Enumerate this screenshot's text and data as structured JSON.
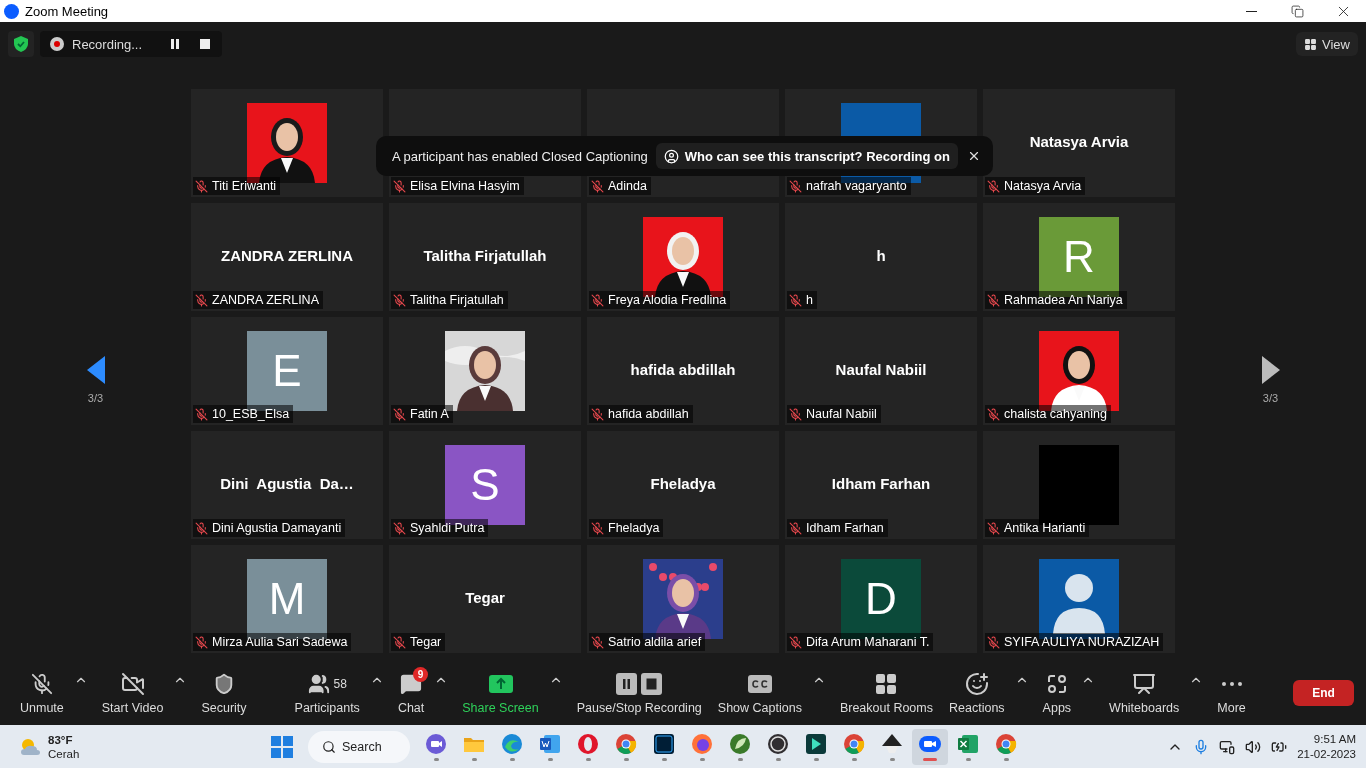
{
  "window": {
    "title": "Zoom Meeting"
  },
  "top_bar": {
    "recording": {
      "label": "Recording..."
    },
    "view": {
      "label": "View"
    }
  },
  "nav": {
    "prev": {
      "page": "3/3",
      "highlighted": true
    },
    "next": {
      "page": "3/3",
      "highlighted": false
    }
  },
  "tiles": [
    {
      "name": "Titi Eriwanti",
      "muted": true
    },
    {
      "kind": "name",
      "name": "Elisa Elvina Hasyim",
      "muted": true
    },
    {
      "kind": "name",
      "name": "Adinda",
      "muted": true
    },
    {
      "kind": "avatar",
      "color": "#0b5aa6",
      "name": "nafrah vagaryanto",
      "muted": true
    },
    {
      "kind": "name",
      "display": "Natasya Arvia",
      "name": "Natasya Arvia",
      "muted": true
    },
    {
      "kind": "name",
      "display": "ZANDRA ZERLINA",
      "name": "ZANDRA ZERLINA",
      "muted": true
    },
    {
      "kind": "name",
      "display": "Talitha Firjatullah",
      "name": "Talitha Firjatullah",
      "muted": true
    },
    {
      "name": "Freya Alodia Fredlina",
      "muted": true
    },
    {
      "kind": "name",
      "display": "h",
      "name": "h",
      "muted": true
    },
    {
      "kind": "avatar",
      "initial": "R",
      "color": "#6a9a38",
      "name": "Rahmadea An Nariya",
      "muted": true
    },
    {
      "kind": "avatar",
      "initial": "E",
      "color": "#7a8f99",
      "name": "10_ESB_Elsa",
      "muted": true
    },
    {
      "name": "Fatin A",
      "muted": true
    },
    {
      "kind": "name",
      "display": "hafida abdillah",
      "name": "hafida abdillah",
      "muted": true
    },
    {
      "kind": "name",
      "display": "Naufal Nabiil",
      "name": "Naufal Nabiil",
      "muted": true
    },
    {
      "name": "chalista cahyaning",
      "muted": true
    },
    {
      "kind": "name",
      "display": "Dini  Agustia  Da…",
      "name": "Dini Agustia Damayanti",
      "muted": true
    },
    {
      "kind": "avatar",
      "initial": "S",
      "color": "#8a55c4",
      "name": "Syahldi Putra",
      "muted": true
    },
    {
      "kind": "name",
      "display": "Fheladya",
      "name": "Fheladya",
      "muted": true
    },
    {
      "kind": "name",
      "display": "Idham Farhan",
      "name": "Idham Farhan",
      "muted": true
    },
    {
      "kind": "blank",
      "name": "Antika Harianti",
      "muted": true
    },
    {
      "kind": "avatar",
      "initial": "M",
      "color": "#7a8f99",
      "name": "Mirza Aulia Sari Sadewa",
      "muted": true
    },
    {
      "kind": "name",
      "display": "Tegar",
      "name": "Tegar",
      "muted": true
    },
    {
      "name": "Satrio aldila arief",
      "muted": true
    },
    {
      "kind": "avatar",
      "initial": "D",
      "color": "#0b4a3a",
      "name": "Difa Arum Maharani T.",
      "muted": true
    },
    {
      "kind": "silhouette",
      "color": "#0b5aa6",
      "name": "SYIFA AULIYA NURAZIZAH",
      "muted": true
    }
  ],
  "banner": {
    "message": "A participant has enabled Closed Captioning",
    "action": "Who can see this transcript? Recording on"
  },
  "toolbar": [
    {
      "kind": "mic",
      "label": "Unmute",
      "caret": true
    },
    {
      "kind": "video",
      "label": "Start Video",
      "caret": true
    },
    {
      "kind": "security",
      "label": "Security",
      "caret": false
    },
    {
      "kind": "participants",
      "label": "Participants",
      "count": "58",
      "caret": true
    },
    {
      "kind": "chat",
      "label": "Chat",
      "badge": "9",
      "caret": true
    },
    {
      "kind": "share",
      "label": "Share Screen",
      "caret": true
    },
    {
      "kind": "record",
      "label": "Pause/Stop Recording",
      "caret": false
    },
    {
      "kind": "captions",
      "label": "Show Captions",
      "caret": true
    },
    {
      "kind": "breakout",
      "label": "Breakout Rooms",
      "caret": false
    },
    {
      "kind": "reactions",
      "label": "Reactions",
      "caret": true
    },
    {
      "kind": "apps",
      "label": "Apps",
      "caret": true
    },
    {
      "kind": "whiteboards",
      "label": "Whiteboards",
      "caret": true
    },
    {
      "kind": "more",
      "label": "More",
      "caret": false
    }
  ],
  "end_button": "End",
  "taskbar": {
    "weather": {
      "temp": "83°F",
      "condition": "Cerah"
    },
    "search": "Search",
    "apps": [
      {
        "kind": "meet",
        "selected": false
      },
      {
        "kind": "folder",
        "selected": false
      },
      {
        "kind": "edge",
        "selected": false
      },
      {
        "kind": "word",
        "selected": false
      },
      {
        "kind": "opera",
        "selected": false
      },
      {
        "kind": "chrome",
        "selected": false
      },
      {
        "kind": "photoshop",
        "selected": false
      },
      {
        "kind": "firefox",
        "selected": false
      },
      {
        "kind": "leaf",
        "selected": false
      },
      {
        "kind": "obs",
        "selected": false
      },
      {
        "kind": "filmora",
        "selected": false
      },
      {
        "kind": "chrome",
        "selected": false
      },
      {
        "kind": "inkscape",
        "selected": false
      },
      {
        "kind": "zoom",
        "selected": true
      },
      {
        "kind": "excel",
        "selected": false
      },
      {
        "kind": "chrome",
        "selected": false
      }
    ],
    "time": "9:51 AM",
    "date": "21-02-2023"
  }
}
